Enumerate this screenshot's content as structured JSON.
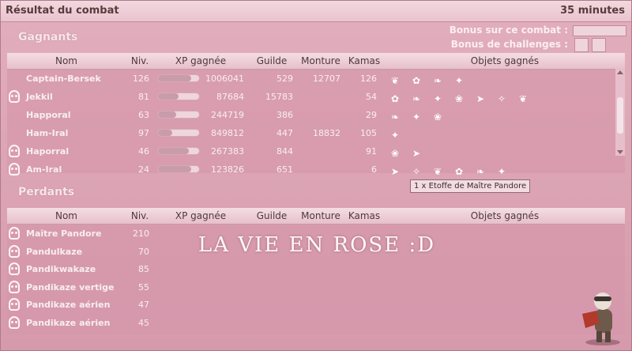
{
  "window": {
    "title": "Résultat du combat",
    "duration": "35 minutes"
  },
  "bonus": {
    "combat_label": "Bonus sur ce combat :",
    "challenges_label": "Bonus de challenges :"
  },
  "sections": {
    "winners": "Gagnants",
    "losers": "Perdants"
  },
  "headers": {
    "name": "Nom",
    "level": "Niv.",
    "xp": "XP gagnée",
    "guild": "Guilde",
    "mount": "Monture",
    "kamas": "Kamas",
    "items": "Objets gagnés"
  },
  "winners": [
    {
      "name": "Captain-Bersek",
      "level": "126",
      "xp": "1006041",
      "xp_fill": 0.8,
      "guild": "529",
      "mount": "12707",
      "kamas": "126",
      "dead": false,
      "items": 4
    },
    {
      "name": "Jekkil",
      "level": "81",
      "xp": "87684",
      "xp_fill": 0.5,
      "guild": "15783",
      "mount": "",
      "kamas": "54",
      "dead": true,
      "items": 7
    },
    {
      "name": "Happoral",
      "level": "63",
      "xp": "244719",
      "xp_fill": 0.45,
      "guild": "386",
      "mount": "",
      "kamas": "29",
      "dead": false,
      "items": 3
    },
    {
      "name": "Ham-Iral",
      "level": "97",
      "xp": "849812",
      "xp_fill": 0.35,
      "guild": "447",
      "mount": "18832",
      "kamas": "105",
      "dead": false,
      "items": 1
    },
    {
      "name": "Haporral",
      "level": "46",
      "xp": "267383",
      "xp_fill": 0.75,
      "guild": "844",
      "mount": "",
      "kamas": "91",
      "dead": true,
      "items": 2
    },
    {
      "name": "Am-Iral",
      "level": "24",
      "xp": "123826",
      "xp_fill": 0.8,
      "guild": "651",
      "mount": "",
      "kamas": "6",
      "dead": true,
      "items": 6
    }
  ],
  "losers": [
    {
      "name": "Maître Pandore",
      "level": "210"
    },
    {
      "name": "Pandulkaze",
      "level": "70"
    },
    {
      "name": "Pandikwakaze",
      "level": "85"
    },
    {
      "name": "Pandikaze vertige",
      "level": "55"
    },
    {
      "name": "Pandikaze aérien",
      "level": "47"
    },
    {
      "name": "Pandikaze aérien",
      "level": "45"
    }
  ],
  "tooltip": "1 x Etoffe de Maître Pandore",
  "overlay_text": "LA VIE EN ROSE :D",
  "icons": {
    "dead": "skull-icon",
    "item": "loot-item-icon",
    "avatar": "character-avatar"
  }
}
